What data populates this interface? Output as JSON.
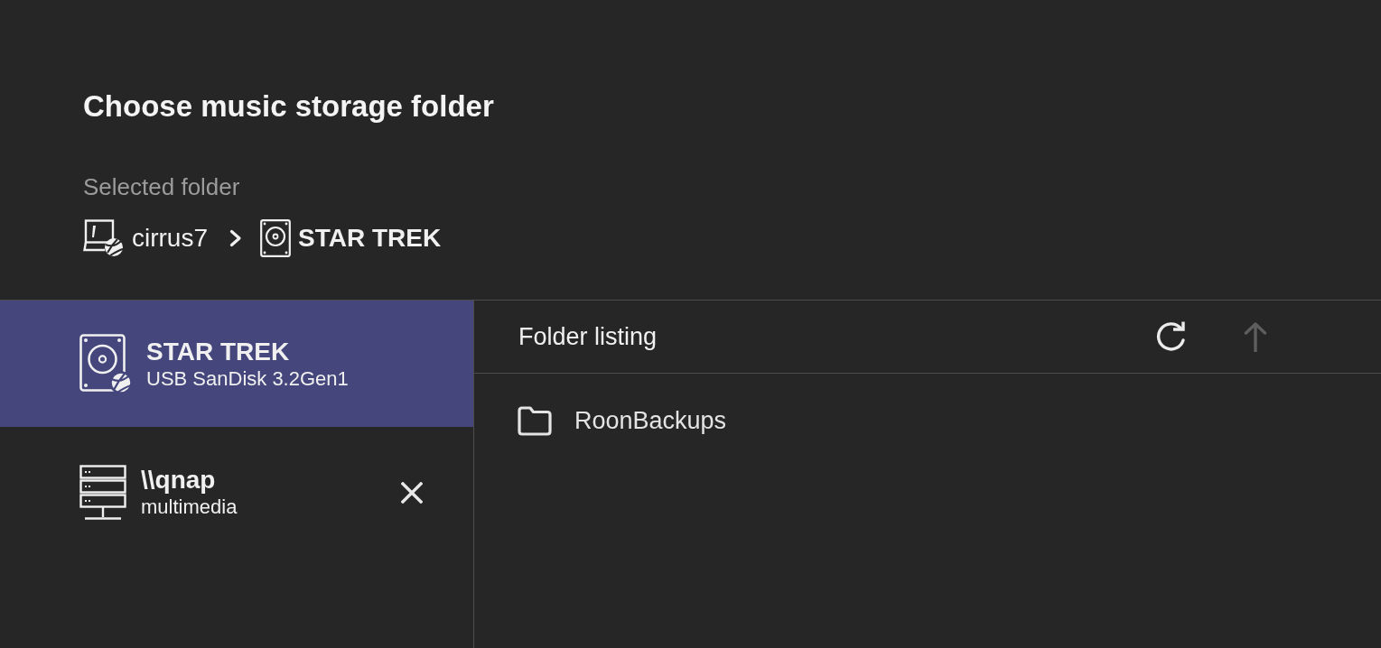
{
  "dialog": {
    "title": "Choose music storage folder",
    "selected_folder": {
      "label": "Selected folder",
      "path": [
        {
          "text": "cirrus7",
          "kind": "computer"
        },
        {
          "text": "STAR TREK",
          "kind": "drive"
        }
      ]
    }
  },
  "locations": [
    {
      "name": "STAR TREK",
      "detail": "USB SanDisk 3.2Gen1",
      "kind": "shared-drive",
      "selected": true,
      "removable": false
    },
    {
      "name": "\\\\qnap",
      "detail": "multimedia",
      "kind": "network",
      "selected": false,
      "removable": true
    }
  ],
  "listing": {
    "title": "Folder listing",
    "up_button": {
      "disabled": true
    },
    "folders": [
      {
        "name": "RoonBackups"
      }
    ]
  }
}
